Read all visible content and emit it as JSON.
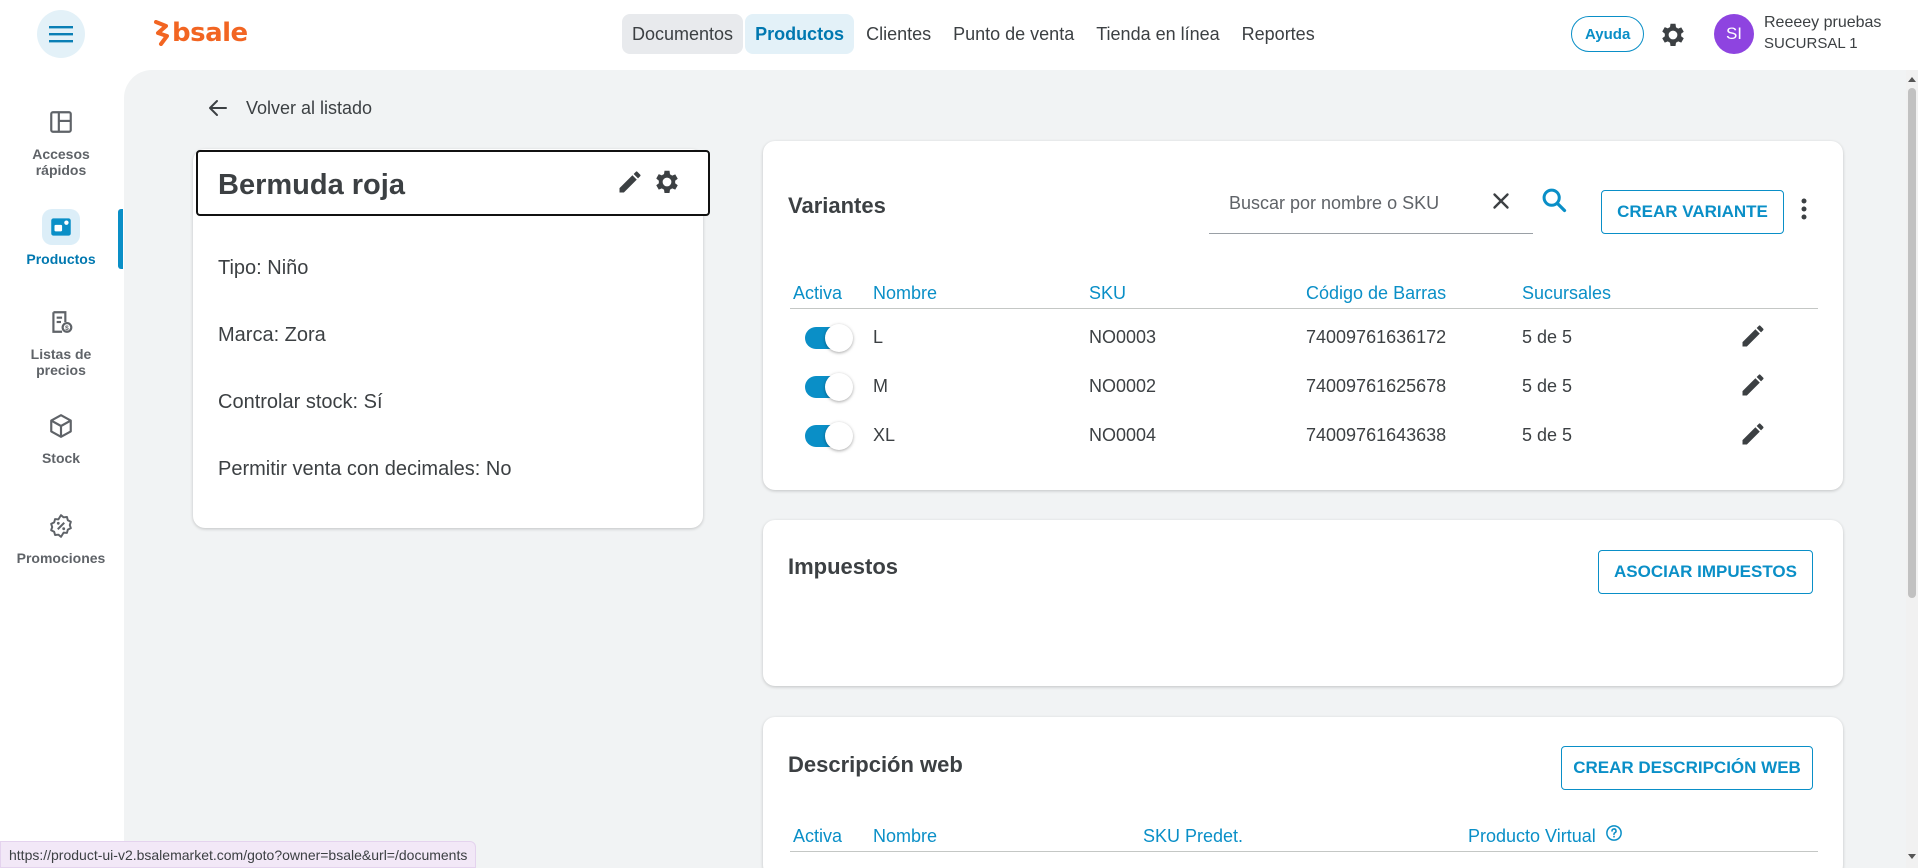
{
  "header": {
    "logo_text": "bsale",
    "nav": [
      "Documentos",
      "Productos",
      "Clientes",
      "Punto de venta",
      "Tienda en línea",
      "Reportes"
    ],
    "help_label": "Ayuda",
    "user": {
      "initials": "SI",
      "name": "Reeeey pruebas",
      "branch": "SUCURSAL 1"
    }
  },
  "sidebar": {
    "items": [
      {
        "label": "Accesos\nrápidos",
        "icon": "dashboard-icon"
      },
      {
        "label": "Productos",
        "icon": "products-icon",
        "active": true
      },
      {
        "label": "Listas de\nprecios",
        "icon": "price-list-icon"
      },
      {
        "label": "Stock",
        "icon": "box-icon"
      },
      {
        "label": "Promociones",
        "icon": "promotion-icon"
      }
    ]
  },
  "back_label": "Volver al listado",
  "product": {
    "title": "Bermuda roja",
    "props": [
      "Tipo: Niño",
      "Marca: Zora",
      "Controlar stock: Sí",
      "Permitir venta con decimales: No"
    ]
  },
  "variants": {
    "title": "Variantes",
    "search_placeholder": "Buscar por nombre o SKU",
    "create_label": "CREAR VARIANTE",
    "headers": [
      "Activa",
      "Nombre",
      "SKU",
      "Código de Barras",
      "Sucursales"
    ],
    "rows": [
      {
        "name": "L",
        "sku": "NO0003",
        "barcode": "74009761636172",
        "branches": "5 de 5",
        "active": true
      },
      {
        "name": "M",
        "sku": "NO0002",
        "barcode": "74009761625678",
        "branches": "5 de 5",
        "active": true
      },
      {
        "name": "XL",
        "sku": "NO0004",
        "barcode": "74009761643638",
        "branches": "5 de 5",
        "active": true
      }
    ]
  },
  "taxes": {
    "title": "Impuestos",
    "button_label": "ASOCIAR IMPUESTOS"
  },
  "web": {
    "title": "Descripción web",
    "button_label": "CREAR DESCRIPCIÓN WEB",
    "headers": [
      "Activa",
      "Nombre",
      "SKU Predet.",
      "Producto Virtual"
    ]
  },
  "status_url": "https://product-ui-v2.bsalemarket.com/goto?owner=bsale&url=/documents",
  "colors": {
    "accent": "#0a8fc7",
    "brand": "#f26522",
    "avatar": "#8e44e0"
  }
}
